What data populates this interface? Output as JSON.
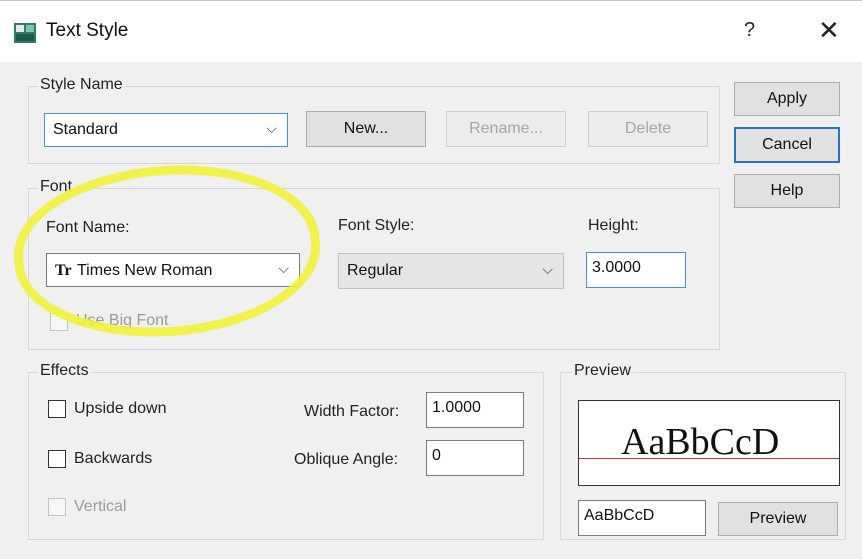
{
  "window": {
    "title": "Text Style",
    "help_glyph": "?",
    "close_glyph": "✕"
  },
  "style_name": {
    "legend": "Style Name",
    "selected": "Standard",
    "new_label": "New...",
    "rename_label": "Rename...",
    "delete_label": "Delete"
  },
  "side_buttons": {
    "apply": "Apply",
    "cancel": "Cancel",
    "help": "Help"
  },
  "font": {
    "legend": "Font",
    "font_name_label": "Font Name:",
    "font_name_icon_text": "Tr",
    "font_name_value": "Times New Roman",
    "font_style_label": "Font Style:",
    "font_style_value": "Regular",
    "height_label": "Height:",
    "height_value": "3.0000",
    "big_font_label": "Use Big Font"
  },
  "effects": {
    "legend": "Effects",
    "upside_down": "Upside down",
    "backwards": "Backwards",
    "vertical": "Vertical",
    "width_factor_label": "Width Factor:",
    "width_factor_value": "1.0000",
    "oblique_angle_label": "Oblique Angle:",
    "oblique_angle_value": "0"
  },
  "preview": {
    "legend": "Preview",
    "sample_text": "AaBbCcD",
    "input_value": "AaBbCcD",
    "button_label": "Preview"
  },
  "colors": {
    "highlight": "#f2f23a",
    "accent": "#2a72c8",
    "baseline": "#c0392b"
  },
  "icons": {
    "app": "autocad-text-style-icon",
    "font_type": "truetype-font-icon",
    "dropdown": "chevron-down-icon"
  }
}
